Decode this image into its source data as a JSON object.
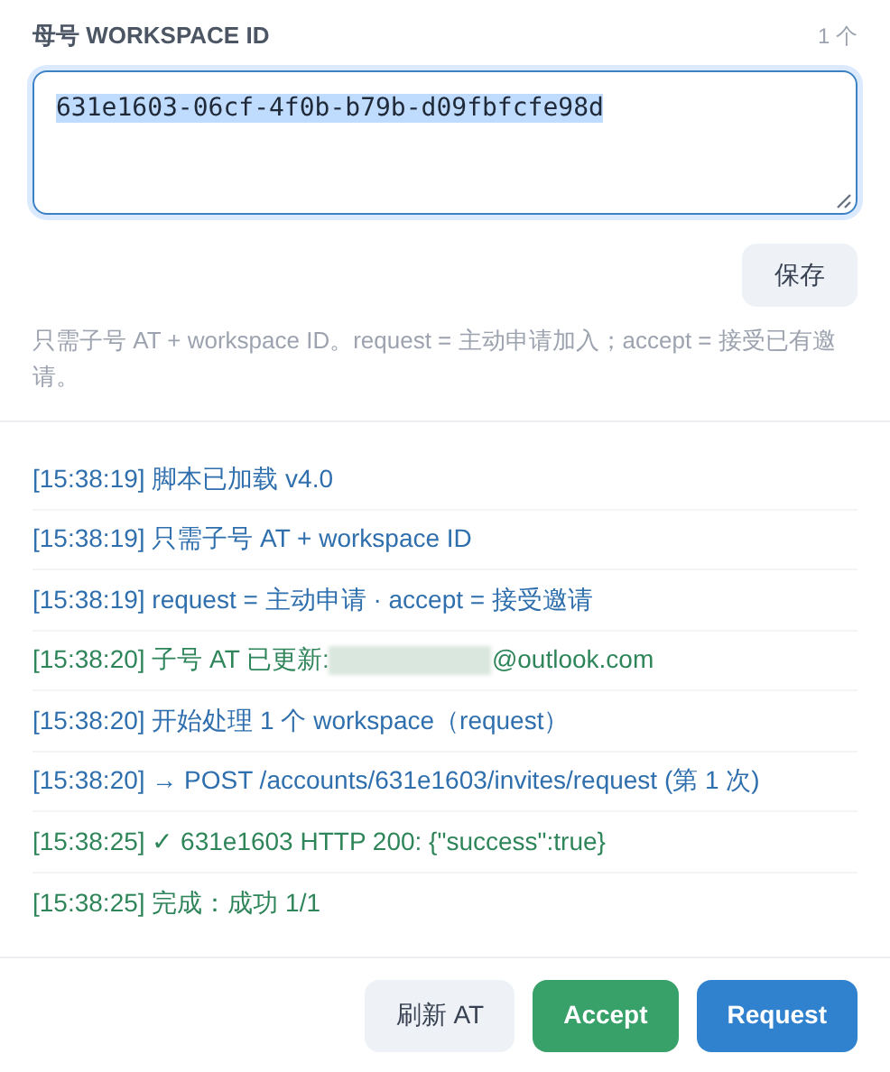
{
  "field": {
    "label": "母号 WORKSPACE ID",
    "count": "1 个",
    "value": "631e1603-06cf-4f0b-b79b-d09fbfcfe98d",
    "value_selected": true
  },
  "save_button": "保存",
  "hint": "只需子号 AT + workspace ID。request = 主动申请加入；accept = 接受已有邀请。",
  "log": [
    {
      "time": "[15:38:19]",
      "text": "脚本已加载 v4.0",
      "kind": "info"
    },
    {
      "time": "[15:38:19]",
      "text": "只需子号 AT + workspace ID",
      "kind": "info"
    },
    {
      "time": "[15:38:19]",
      "text": "request = 主动申请 · accept = 接受邀请",
      "kind": "info"
    },
    {
      "time": "[15:38:20]",
      "text": "子号 AT 已更新:",
      "redacted": true,
      "after": "@outlook.com",
      "kind": "success"
    },
    {
      "time": "[15:38:20]",
      "text": "开始处理 1 个 workspace（request）",
      "kind": "info"
    },
    {
      "time": "[15:38:20]",
      "text": "→ POST /accounts/631e1603/invites/request (第 1 次)",
      "kind": "info"
    },
    {
      "time": "[15:38:25]",
      "text": "✓ 631e1603 HTTP 200: {\"success\":true}",
      "kind": "success"
    },
    {
      "time": "[15:38:25]",
      "text": "完成：成功 1/1",
      "kind": "success"
    }
  ],
  "buttons": [
    {
      "label": "刷新 AT",
      "kind": "neutral"
    },
    {
      "label": "Accept",
      "kind": "accept"
    },
    {
      "label": "Request",
      "kind": "request"
    }
  ]
}
